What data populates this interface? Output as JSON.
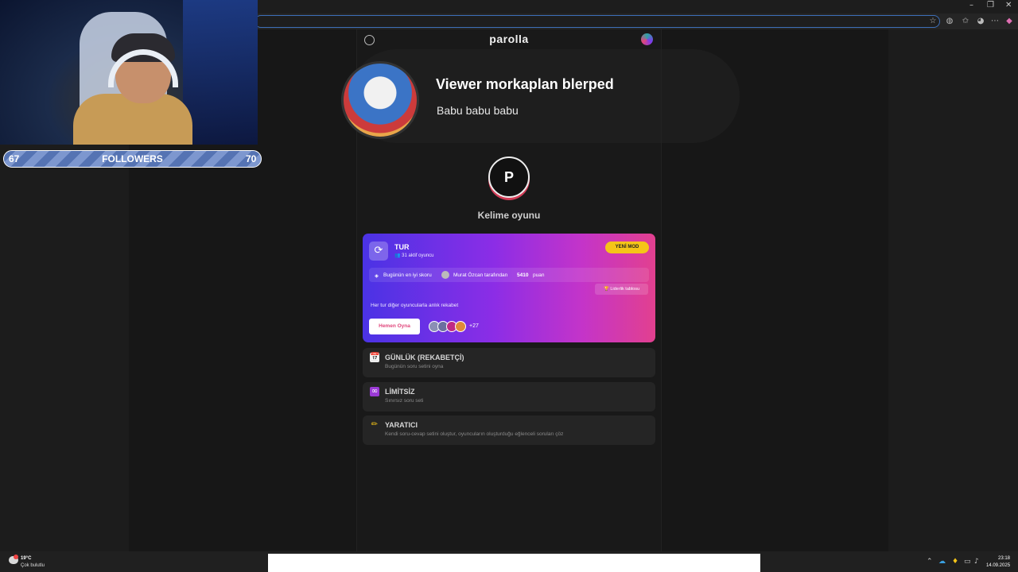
{
  "browser": {
    "window_controls": {
      "minimize": "–",
      "restore": "❐",
      "close": "✕"
    }
  },
  "stream": {
    "followers": {
      "current": "67",
      "label": "FOLLOWERS",
      "goal": "70"
    }
  },
  "alert": {
    "title": "Viewer morkaplan blerped",
    "message": "Babu babu babu"
  },
  "app": {
    "brand": "parolla",
    "logo_letter": "P",
    "subtitle": "Kelime oyunu"
  },
  "card": {
    "title": "TUR",
    "players": "31 aktif oyuncu",
    "badge": "YENİ MOD",
    "score_label": "Bugünün en iyi skoru",
    "score_by": "Murat Özcan tarafından",
    "score_value": "5410",
    "score_unit": "puan",
    "leaderboard": "Liderlik tablosu",
    "description": "Her tur diğer oyuncularla anlık rekabet",
    "play_button": "Hemen Oyna",
    "more_players": "+27"
  },
  "modes": [
    {
      "icon": "📅",
      "title": "GÜNLÜK (REKABETÇİ)",
      "subtitle": "Bugünün soru setini oyna"
    },
    {
      "icon": "∞",
      "title": "LİMİTSİZ",
      "subtitle": "Sınırsız soru seti"
    },
    {
      "icon": "✏",
      "title": "YARATICI",
      "subtitle": "Kendi soru-cevap setini oluştur, oyuncuların oluşturduğu eğlenceli soruları çöz"
    }
  ],
  "taskbar": {
    "temp": "19°C",
    "weather": "Çok bulutlu",
    "time": "23:18",
    "date": "14.09.2025"
  },
  "colors": {
    "card_gradient_start": "#4a33e5",
    "card_gradient_end": "#e2408f",
    "badge": "#f5c518",
    "logo_accent": "#d23d57"
  }
}
